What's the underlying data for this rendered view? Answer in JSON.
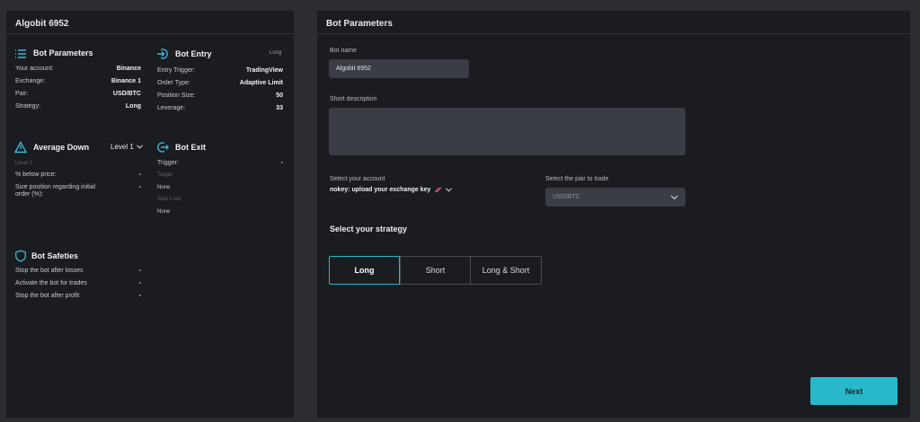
{
  "left": {
    "title": "Algobit 6952",
    "params": {
      "title": "Bot Parameters",
      "rows": [
        {
          "k": "Your account:",
          "v": "Binance"
        },
        {
          "k": "Exchange:",
          "v": "Binance 1"
        },
        {
          "k": "Pair:",
          "v": "USD/BTC"
        },
        {
          "k": "Strategy:",
          "v": "Long"
        }
      ]
    },
    "entry": {
      "title": "Bot Entry",
      "tag": "Long",
      "rows": [
        {
          "k": "Entry Trigger:",
          "v": "TradingView"
        },
        {
          "k": "Order Type:",
          "v": "Adaptive Limit"
        },
        {
          "k": "Position Size:",
          "v": "50"
        },
        {
          "k": "Leverage:",
          "v": "33"
        }
      ]
    },
    "avg": {
      "title": "Average Down",
      "level_select": "Level 1",
      "level_label": "Level 1",
      "rows": [
        {
          "k": "% below price:",
          "v": "-"
        },
        {
          "k": "Size position regarding initial order (%):",
          "v": "-"
        }
      ]
    },
    "exit": {
      "title": "Bot Exit",
      "trigger_k": "Trigger:",
      "trigger_v": "-",
      "target_label": "Target",
      "target_value": "None",
      "stop_label": "Stop Loss",
      "stop_value": "None"
    },
    "safeties": {
      "title": "Bot Safeties",
      "rows": [
        {
          "k": "Stop the bot after losses",
          "v": "-"
        },
        {
          "k": "Activate the bot for trades",
          "v": "-"
        },
        {
          "k": "Stop the bot after profit",
          "v": "-"
        }
      ]
    }
  },
  "right": {
    "title": "Bot Parameters",
    "bot_name_label": "Bot name",
    "bot_name_value": "Algobit 6952",
    "short_desc_label": "Short description",
    "account_label": "Select your account",
    "account_value": "nokey: upload your exchange key",
    "pair_label": "Select the pair to trade",
    "pair_value": "USD/BTC",
    "strategy_label": "Select your strategy",
    "strategies": [
      "Long",
      "Short",
      "Long & Short"
    ],
    "next_label": "Next"
  },
  "colors": {
    "accent": "#27b9c9",
    "panel": "#1a1c20",
    "bg": "#2b2d33"
  }
}
